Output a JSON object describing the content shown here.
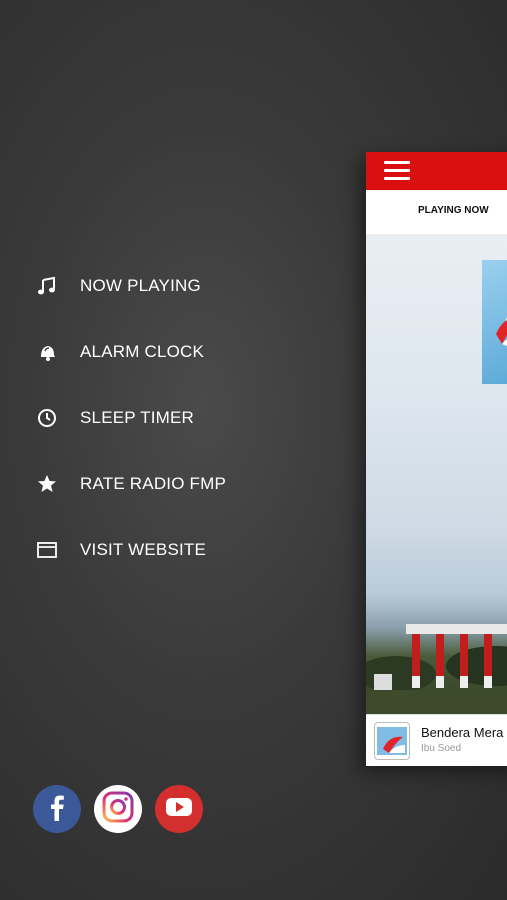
{
  "menu": {
    "items": [
      {
        "label": "NOW PLAYING",
        "icon": "music-note-icon"
      },
      {
        "label": "ALARM CLOCK",
        "icon": "bell-icon"
      },
      {
        "label": "SLEEP TIMER",
        "icon": "clock-icon"
      },
      {
        "label": "RATE RADIO FMP",
        "icon": "star-icon"
      },
      {
        "label": "VISIT WEBSITE",
        "icon": "browser-window-icon"
      }
    ]
  },
  "social": [
    {
      "name": "facebook",
      "icon": "facebook-icon",
      "color": "#3b5998"
    },
    {
      "name": "instagram",
      "icon": "instagram-icon",
      "color": "#ffffff"
    },
    {
      "name": "youtube",
      "icon": "youtube-icon",
      "color": "#d32f2f"
    }
  ],
  "app": {
    "accent": "#d9100f",
    "tab_label": "PLAYING NOW",
    "now_playing": {
      "title": "Bendera Mera",
      "artist": "Ibu Soed"
    }
  }
}
